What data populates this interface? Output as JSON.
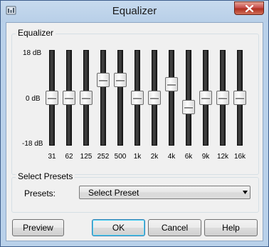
{
  "window": {
    "title": "Equalizer",
    "app_icon": "equalizer-app-icon",
    "close_icon": "close-icon"
  },
  "equalizer": {
    "group_label": "Equalizer",
    "scale": {
      "top": "18 dB",
      "mid": "0 dB",
      "bottom": "-18 dB"
    },
    "bands": [
      {
        "freq": "31",
        "level_db": 0
      },
      {
        "freq": "62",
        "level_db": 0
      },
      {
        "freq": "125",
        "level_db": 0
      },
      {
        "freq": "252",
        "level_db": 8
      },
      {
        "freq": "500",
        "level_db": 8
      },
      {
        "freq": "1k",
        "level_db": 0
      },
      {
        "freq": "2k",
        "level_db": 0
      },
      {
        "freq": "4k",
        "level_db": 6
      },
      {
        "freq": "6k",
        "level_db": -4
      },
      {
        "freq": "9k",
        "level_db": 0
      },
      {
        "freq": "12k",
        "level_db": 0
      },
      {
        "freq": "16k",
        "level_db": 0
      }
    ]
  },
  "presets": {
    "group_label": "Select Presets",
    "field_label": "Presets:",
    "selected": "Select Preset"
  },
  "buttons": {
    "preview": "Preview",
    "ok": "OK",
    "cancel": "Cancel",
    "help": "Help"
  },
  "colors": {
    "title_bar": "#b9d1ea",
    "close_button": "#c75050",
    "dialog_face": "#f0f0f0",
    "default_button_border": "#3c7fb1"
  }
}
